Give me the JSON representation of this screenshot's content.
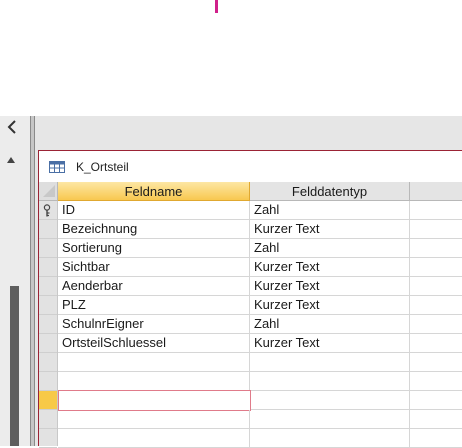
{
  "colors": {
    "accent_pink": "#d0208a",
    "selected_header": "#f8c850",
    "border_accent": "#9b2335"
  },
  "nav": {
    "collapse_icon": "chevron-left-icon",
    "scroll_up_icon": "triangle-up-icon"
  },
  "document": {
    "tab_icon": "table-icon",
    "title": "K_Ortsteil"
  },
  "grid": {
    "headers": {
      "name": "Feldname",
      "type": "Felddatentyp",
      "description": ""
    },
    "key_icon": "primary-key-icon",
    "rows": [
      {
        "name": "ID",
        "type": "Zahl"
      },
      {
        "name": "Bezeichnung",
        "type": "Kurzer Text"
      },
      {
        "name": "Sortierung",
        "type": "Zahl"
      },
      {
        "name": "Sichtbar",
        "type": "Kurzer Text"
      },
      {
        "name": "Aenderbar",
        "type": "Kurzer Text"
      },
      {
        "name": "PLZ",
        "type": "Kurzer Text"
      },
      {
        "name": "SchulnrEigner",
        "type": "Zahl"
      },
      {
        "name": "OrtsteilSchluessel",
        "type": "Kurzer Text"
      },
      {
        "name": "",
        "type": ""
      },
      {
        "name": "",
        "type": ""
      },
      {
        "name": "",
        "type": ""
      },
      {
        "name": "",
        "type": ""
      },
      {
        "name": "",
        "type": ""
      }
    ]
  }
}
